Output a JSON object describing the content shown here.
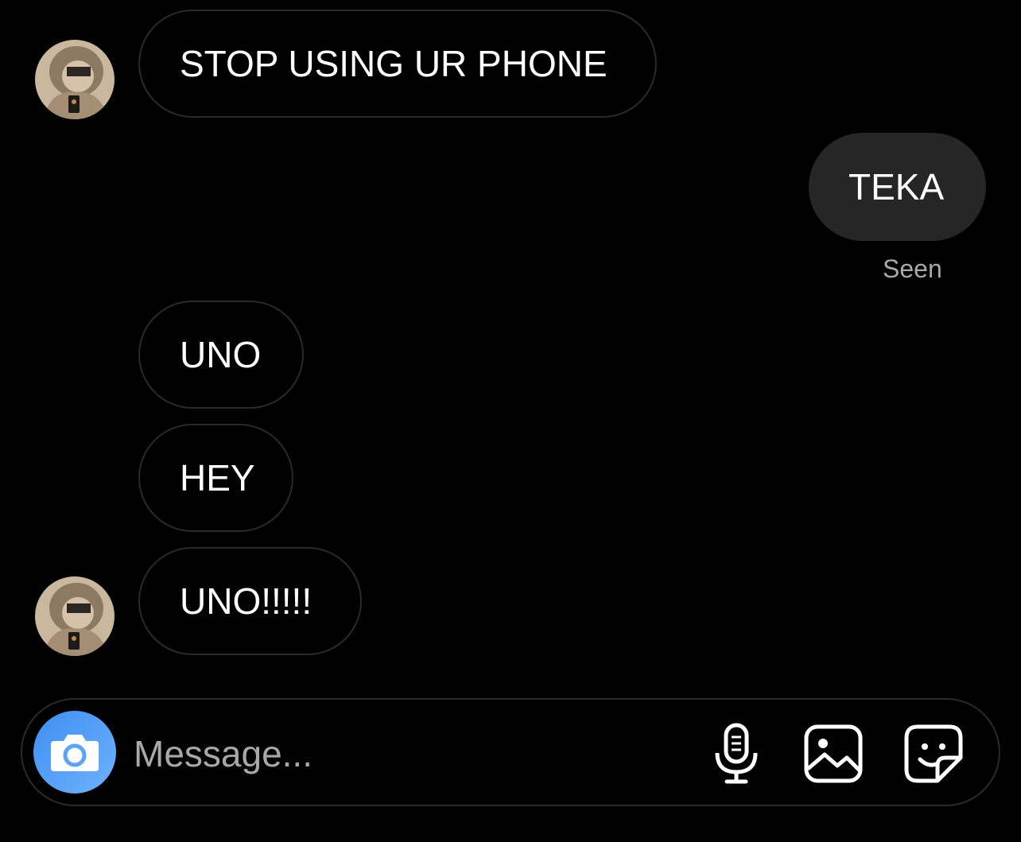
{
  "conversation": {
    "messages": [
      {
        "direction": "incoming",
        "text": "STOP USING UR PHONE"
      },
      {
        "direction": "outgoing",
        "text": "TEKA"
      },
      {
        "direction": "incoming",
        "text": "UNO"
      },
      {
        "direction": "incoming",
        "text": "HEY"
      },
      {
        "direction": "incoming",
        "text": "UNO!!!!!"
      }
    ],
    "seen_label": "Seen"
  },
  "composer": {
    "placeholder": "Message...",
    "value": "",
    "icons": {
      "camera": "camera-icon",
      "microphone": "microphone-icon",
      "gallery": "gallery-icon",
      "sticker": "sticker-icon"
    },
    "accent_color": "#3d8ef0"
  },
  "colors": {
    "background": "#000000",
    "incoming_bubble_border": "#2a2a2a",
    "outgoing_bubble_fill": "#262626",
    "secondary_text": "#a8a8a8"
  }
}
